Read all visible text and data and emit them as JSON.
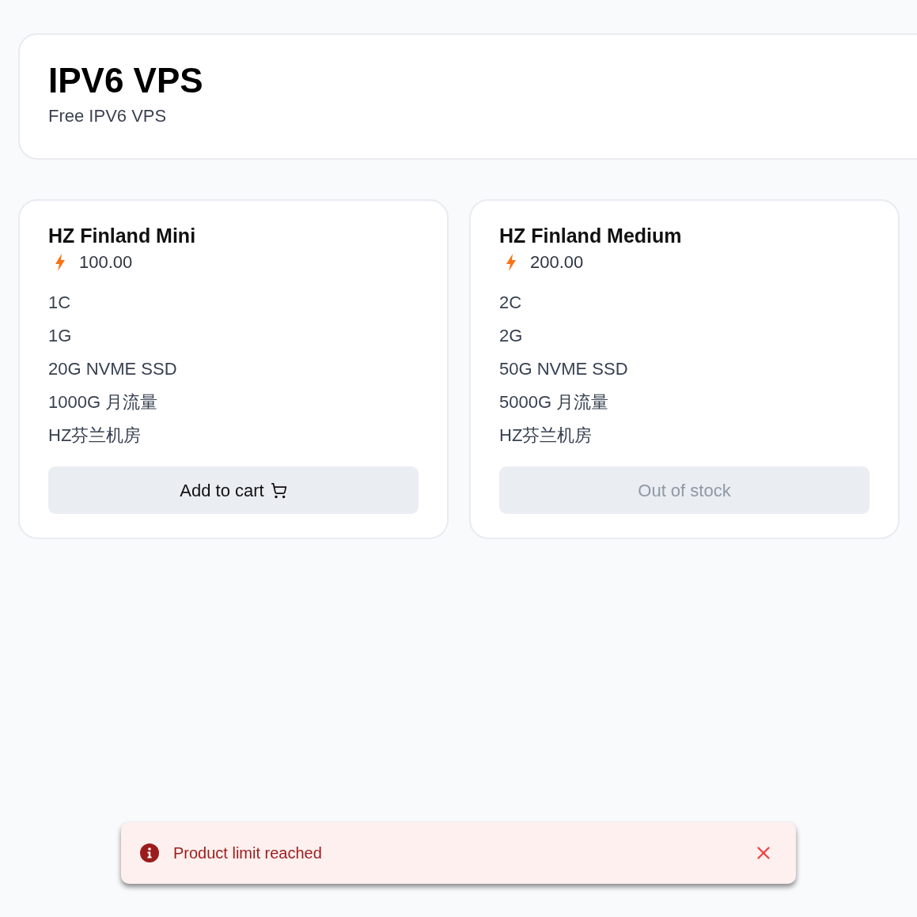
{
  "header": {
    "title": "IPV6 VPS",
    "subtitle": "Free IPV6 VPS"
  },
  "products": [
    {
      "name": "HZ Finland Mini",
      "price": "100.00",
      "specs": [
        "1C",
        "1G",
        "20G NVME SSD",
        "1000G 月流量",
        "HZ芬兰机房"
      ],
      "button": {
        "label": "Add to cart",
        "disabled": false
      }
    },
    {
      "name": "HZ Finland Medium",
      "price": "200.00",
      "specs": [
        "2C",
        "2G",
        "50G NVME SSD",
        "5000G 月流量",
        "HZ芬兰机房"
      ],
      "button": {
        "label": "Out of stock",
        "disabled": true
      }
    }
  ],
  "toast": {
    "kind": "error",
    "message": "Product limit reached"
  }
}
